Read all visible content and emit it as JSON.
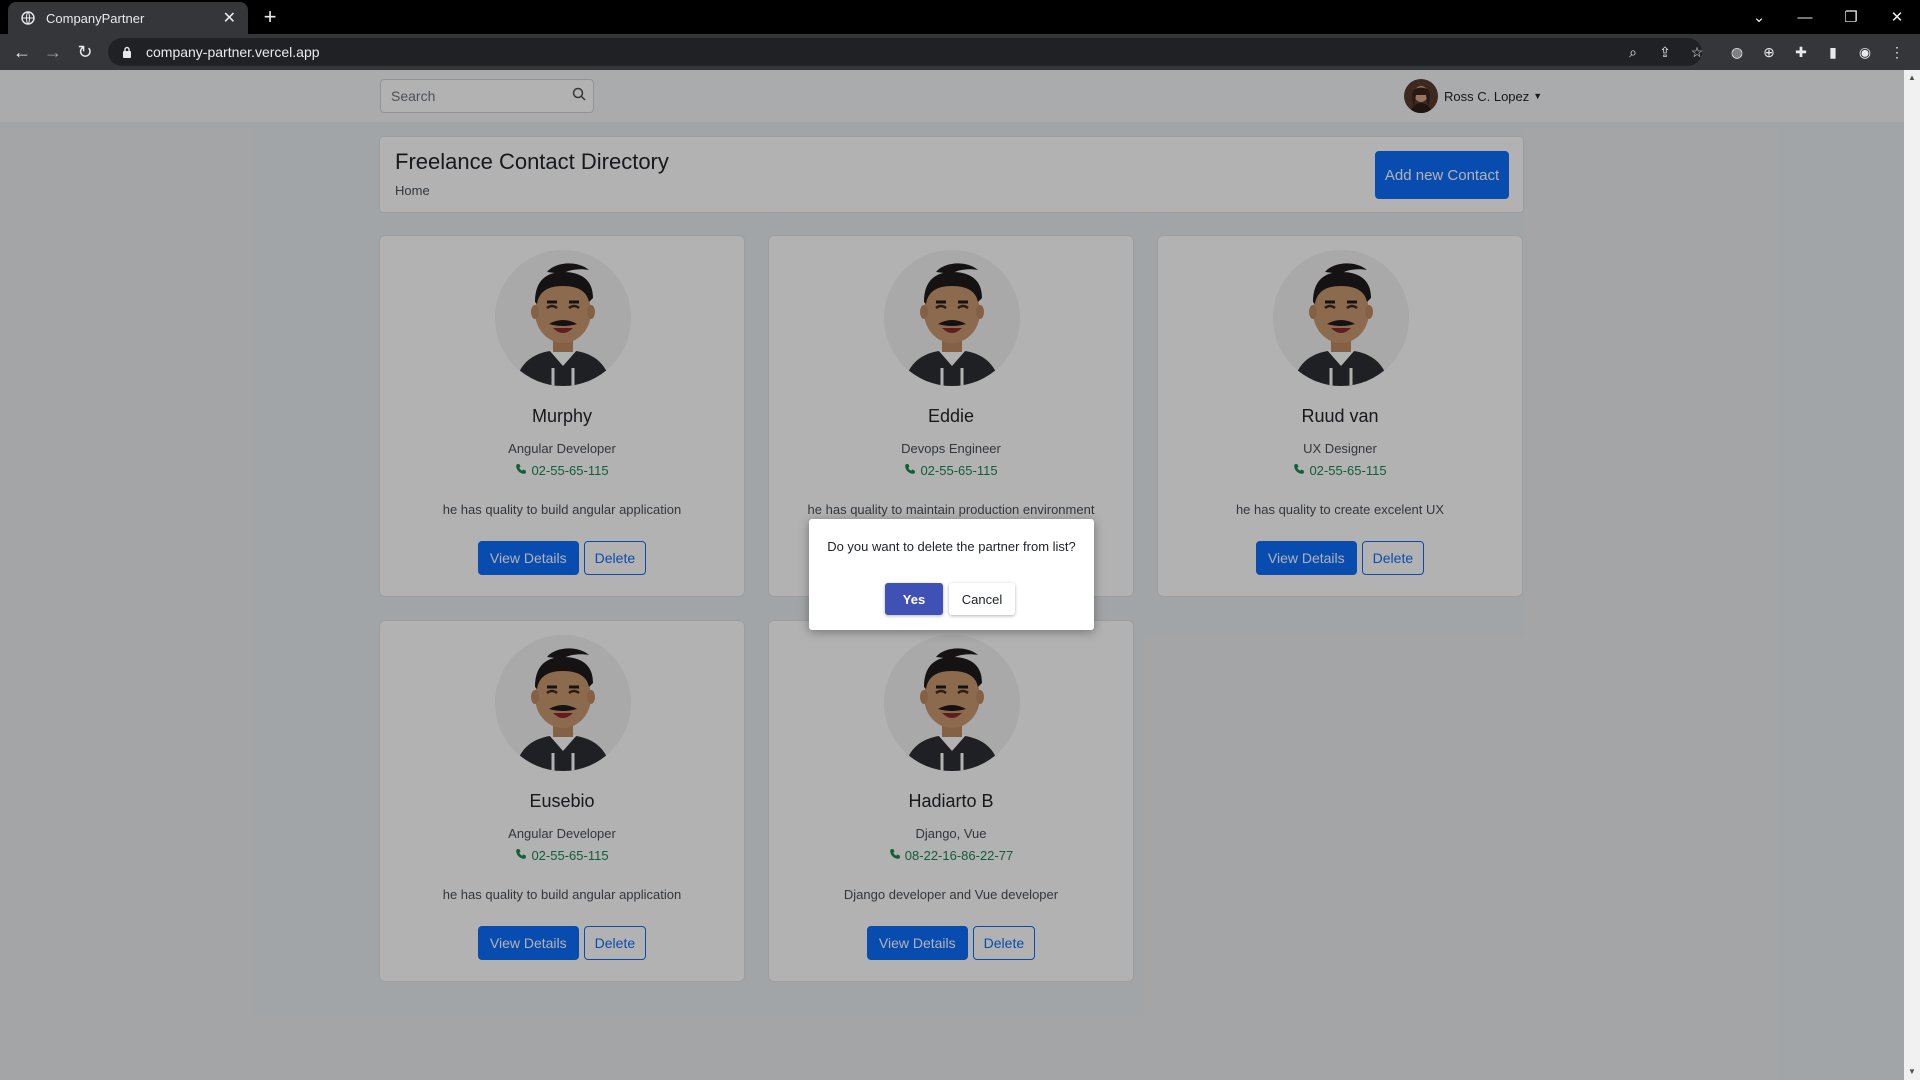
{
  "browser": {
    "tab_title": "CompanyPartner",
    "url": "company-partner.vercel.app",
    "icons": [
      "back-icon",
      "forward-icon",
      "reload-icon",
      "lock-icon",
      "zoom-icon",
      "share-icon",
      "star-icon",
      "extension-icon",
      "profile-icon",
      "menu-icon"
    ]
  },
  "topnav": {
    "search_placeholder": "Search",
    "user_name": "Ross C. Lopez"
  },
  "header": {
    "title": "Freelance Contact Directory",
    "breadcrumb": "Home",
    "add_button": "Add new Contact"
  },
  "contacts": [
    {
      "name": "Murphy",
      "role": "Angular Developer",
      "phone": "02-55-65-115",
      "description": "he has quality to build angular application"
    },
    {
      "name": "Eddie",
      "role": "Devops Engineer",
      "phone": "02-55-65-115",
      "description": "he has quality to maintain production environment"
    },
    {
      "name": "Ruud van",
      "role": "UX Designer",
      "phone": "02-55-65-115",
      "description": "he has quality to create excelent UX"
    },
    {
      "name": "Eusebio",
      "role": "Angular Developer",
      "phone": "02-55-65-115",
      "description": "he has quality to build angular application"
    },
    {
      "name": "Hadiarto B",
      "role": "Django, Vue",
      "phone": "08-22-16-86-22-77",
      "description": "Django developer and Vue developer"
    }
  ],
  "card_actions": {
    "view_details": "View Details",
    "delete": "Delete"
  },
  "dialog": {
    "message": "Do you want to delete the partner from list?",
    "yes": "Yes",
    "cancel": "Cancel"
  },
  "colors": {
    "primary": "#0d6efd",
    "dialog_yes": "#3f51b5",
    "phone": "#198754"
  }
}
